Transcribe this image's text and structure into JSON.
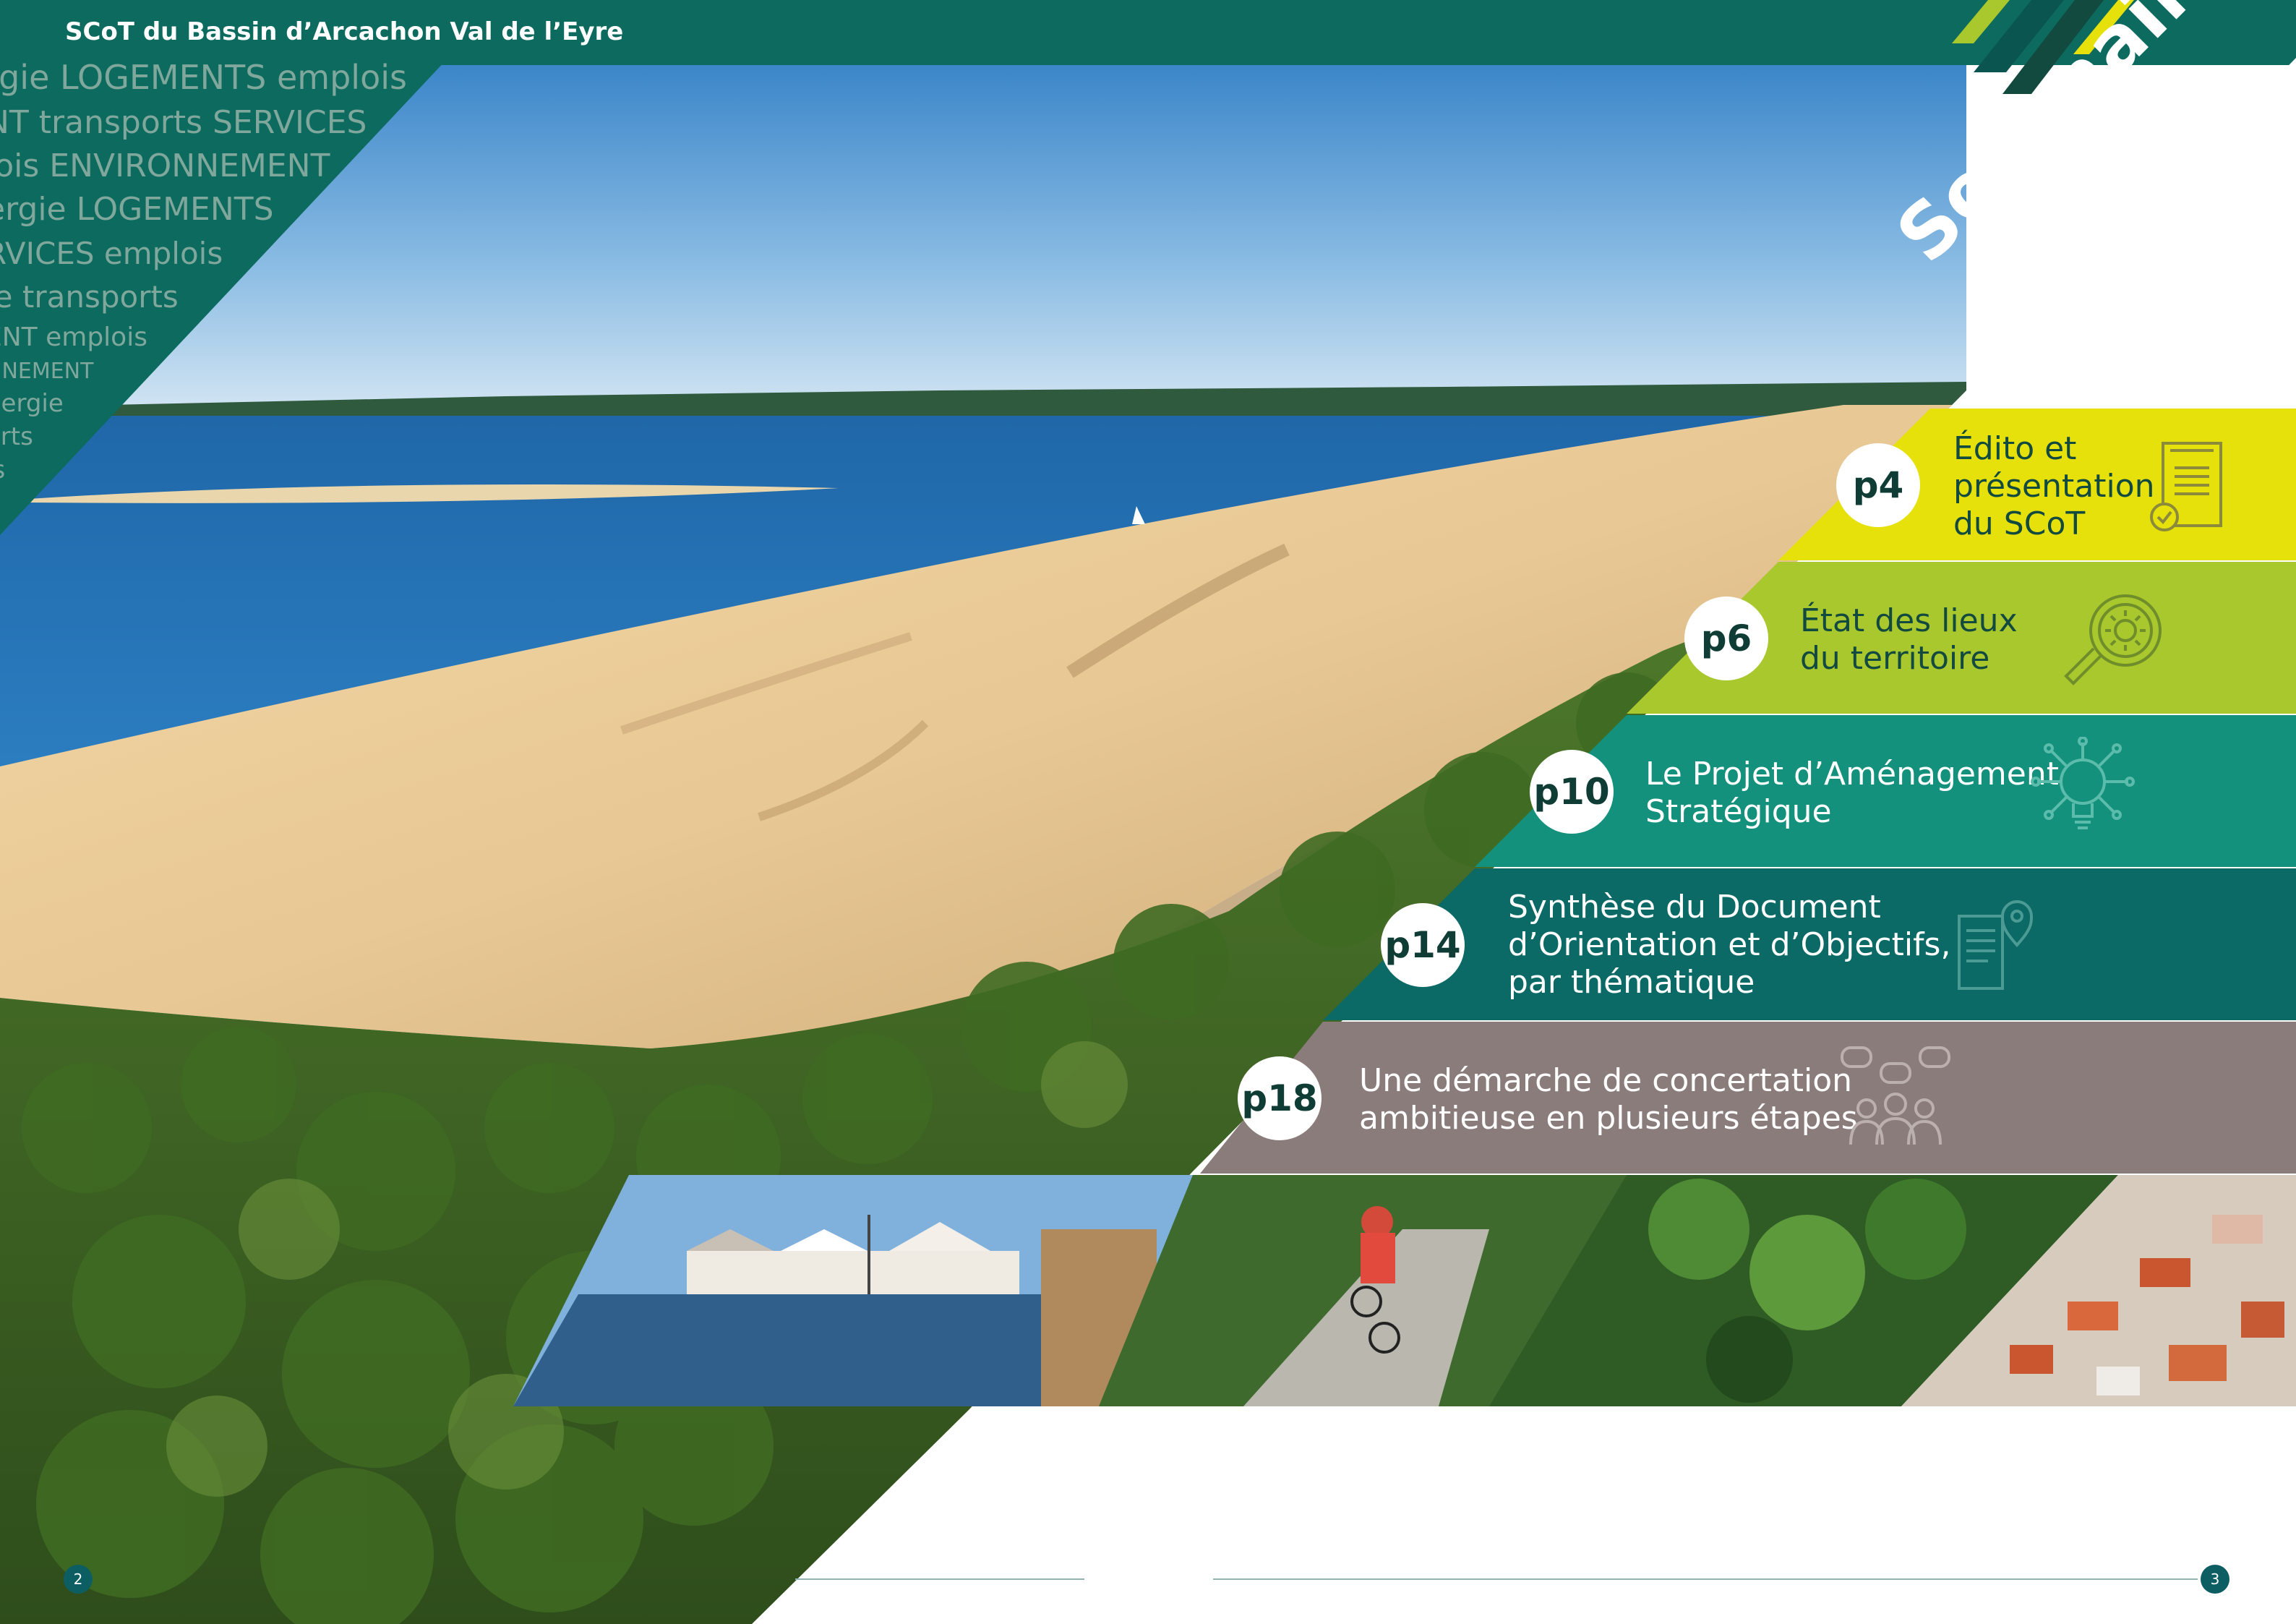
{
  "header": {
    "title": "SCoT du Bassin d’Arcachon Val de l’Eyre"
  },
  "wordcloud": [
    {
      "text": "rgie  LOGEMENTS  emplois",
      "size": 46
    },
    {
      "text": "NT  transports  SERVICES",
      "size": 44
    },
    {
      "text": "lois  ENVIRONNEMENT",
      "size": 44
    },
    {
      "text": "ergie  LOGEMENTS",
      "size": 44
    },
    {
      "text": "RVICES  emplois",
      "size": 42
    },
    {
      "text": "ie  transports",
      "size": 42
    },
    {
      "text": "ENT  emplois",
      "size": 36
    },
    {
      "text": "NNEMENT",
      "size": 30
    },
    {
      "text": "nergie",
      "size": 34
    },
    {
      "text": "orts",
      "size": 34
    },
    {
      "text": "is",
      "size": 34
    }
  ],
  "sommaire": {
    "title": "Sommaire"
  },
  "toc": [
    {
      "page": "p4",
      "line1": "Édito et",
      "line2": "présentation",
      "line3": "du SCoT",
      "color": "#e6e10a",
      "text_color": "#134a3f",
      "icon": "document-check-icon"
    },
    {
      "page": "p6",
      "line1": "État des lieux",
      "line2": "du territoire",
      "line3": "",
      "color": "#a9c82d",
      "text_color": "#134a3f",
      "icon": "magnifier-gear-icon"
    },
    {
      "page": "p10",
      "line1": "Le Projet d’Aménagement",
      "line2": "Stratégique",
      "line3": "",
      "color": "#14917c",
      "text_color": "#ffffff",
      "icon": "lightbulb-circuit-icon"
    },
    {
      "page": "p14",
      "line1": "Synthèse du Document",
      "line2": "d’Orientation et d’Objectifs,",
      "line3": "par thématique",
      "color": "#0b6a66",
      "text_color": "#ffffff",
      "icon": "map-pin-document-icon"
    },
    {
      "page": "p18",
      "line1": "Une démarche de concertation",
      "line2": "ambitieuse en plusieurs étapes",
      "line3": "",
      "color": "#8a7c7b",
      "text_color": "#ffffff",
      "icon": "group-discussion-icon"
    }
  ],
  "photos": [
    {
      "name": "dune-du-pilat-photo"
    },
    {
      "name": "harbour-photo"
    },
    {
      "name": "cycling-path-photo"
    },
    {
      "name": "forest-photo"
    },
    {
      "name": "town-aerial-photo"
    }
  ],
  "footer": {
    "left_page": "2",
    "right_page": "3"
  },
  "colors": {
    "header": "#0c6a5e",
    "accent_yellow": "#e6e10a",
    "accent_green": "#a9c82d"
  }
}
